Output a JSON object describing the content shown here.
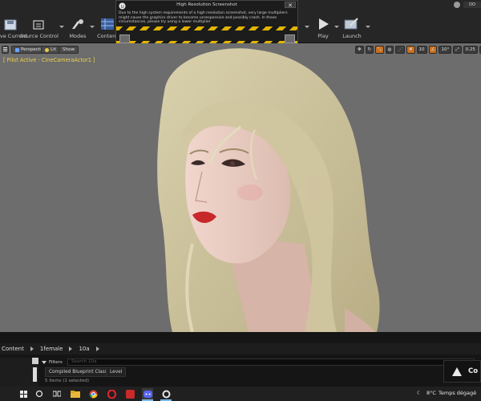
{
  "toolbar": {
    "save_current": "Save Current",
    "source_control": "Source Control",
    "modes": "Modes",
    "content": "Content",
    "play": "Play",
    "launch": "Launch"
  },
  "dialog": {
    "title": "High Resolution Screenshot",
    "close": "✕",
    "message": "Due to the high system requirements of a high resolution screenshot, very large multipliers might cause the graphics driver to become unresponsive and possibly crash. In these circumstances, please try using a lower multiplier"
  },
  "viewport": {
    "perspective": "Perspective",
    "lit": "Lit",
    "show": "Show",
    "pilot": "[ Pilot Active - CineCameraActor1 ]",
    "tools": {
      "grid": "10",
      "angle": "10°",
      "scale": "0.25",
      "cam": "1"
    }
  },
  "content_browser": {
    "crumbs": [
      "Content",
      "1female",
      "10a"
    ],
    "filters": "Filters",
    "search_placeholder": "Search 10a",
    "chip_blueprint": "Compiled Blueprint Class",
    "chip_level": "Level",
    "items_count": "5 items (1 selected)"
  },
  "notification": {
    "text": "Co"
  },
  "taskbar": {
    "weather": "8°C",
    "weather_text": "Temps dégagé"
  }
}
